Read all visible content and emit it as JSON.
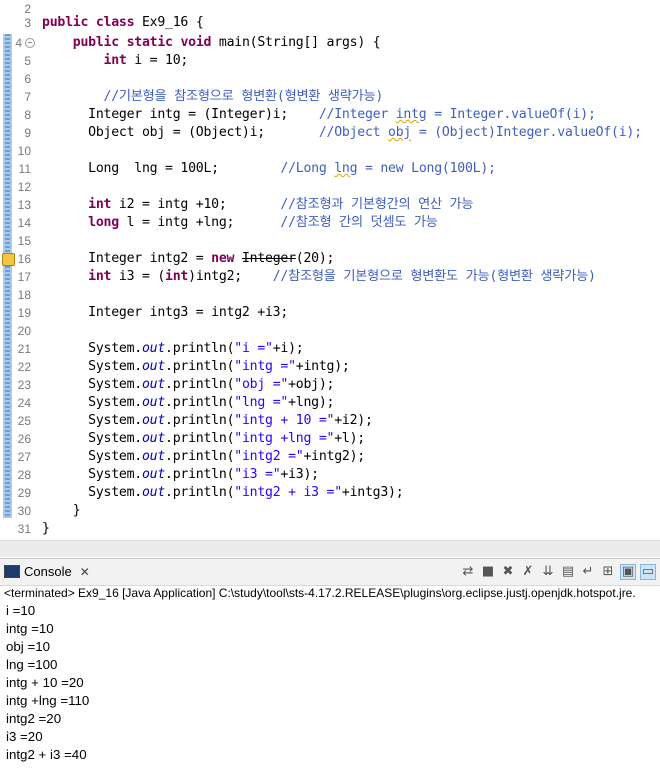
{
  "editor": {
    "lines": [
      {
        "n": "2",
        "t": ""
      },
      {
        "n": "3",
        "t": "public class Ex9_16 {"
      },
      {
        "n": "4",
        "t": "    public static void main(String[] args) {"
      },
      {
        "n": "5",
        "t": "        int i = 10;"
      },
      {
        "n": "6",
        "t": ""
      },
      {
        "n": "7",
        "t": "        //기본형을 참조형으로 형변환(형변환 생략가능)"
      },
      {
        "n": "8",
        "t": "      Integer intg = (Integer)i;    //Integer intg = Integer.valueOf(i);"
      },
      {
        "n": "9",
        "t": "      Object obj = (Object)i;       //Object obj = (Object)Integer.valueOf(i);"
      },
      {
        "n": "10",
        "t": ""
      },
      {
        "n": "11",
        "t": "      Long  lng = 100L;        //Long lng = new Long(100L);"
      },
      {
        "n": "12",
        "t": ""
      },
      {
        "n": "13",
        "t": "      int i2 = intg +10;       //참조형과 기본형간의 연산 가능"
      },
      {
        "n": "14",
        "t": "      long l = intg +lng;      //참조형 간의 덧셈도 가능"
      },
      {
        "n": "15",
        "t": ""
      },
      {
        "n": "16",
        "t": "      Integer intg2 = new Integer(20);"
      },
      {
        "n": "17",
        "t": "      int i3 = (int)intg2;    //참조형을 기본형으로 형변환도 가능(형변환 생략가능)"
      },
      {
        "n": "18",
        "t": ""
      },
      {
        "n": "19",
        "t": "      Integer intg3 = intg2 +i3;"
      },
      {
        "n": "20",
        "t": ""
      },
      {
        "n": "21",
        "t": "      System.out.println(\"i =\"+i);"
      },
      {
        "n": "22",
        "t": "      System.out.println(\"intg =\"+intg);"
      },
      {
        "n": "23",
        "t": "      System.out.println(\"obj =\"+obj);"
      },
      {
        "n": "24",
        "t": "      System.out.println(\"lng =\"+lng);"
      },
      {
        "n": "25",
        "t": "      System.out.println(\"intg + 10 =\"+i2);"
      },
      {
        "n": "26",
        "t": "      System.out.println(\"intg +lng =\"+l);"
      },
      {
        "n": "27",
        "t": "      System.out.println(\"intg2 =\"+intg2);"
      },
      {
        "n": "28",
        "t": "      System.out.println(\"i3 =\"+i3);"
      },
      {
        "n": "29",
        "t": "      System.out.println(\"intg2 + i3 =\"+intg3);"
      },
      {
        "n": "30",
        "t": "    }"
      },
      {
        "n": "31",
        "t": "}"
      }
    ]
  },
  "console": {
    "tab_label": "Console",
    "status": "<terminated> Ex9_16 [Java Application] C:\\study\\tool\\sts-4.17.2.RELEASE\\plugins\\org.eclipse.justj.openjdk.hotspot.jre.",
    "output": [
      "i =10",
      "intg =10",
      "obj =10",
      "lng =100",
      "intg + 10 =20",
      "intg +lng =110",
      "intg2 =20",
      "i3 =20",
      "intg2 + i3 =40"
    ]
  }
}
